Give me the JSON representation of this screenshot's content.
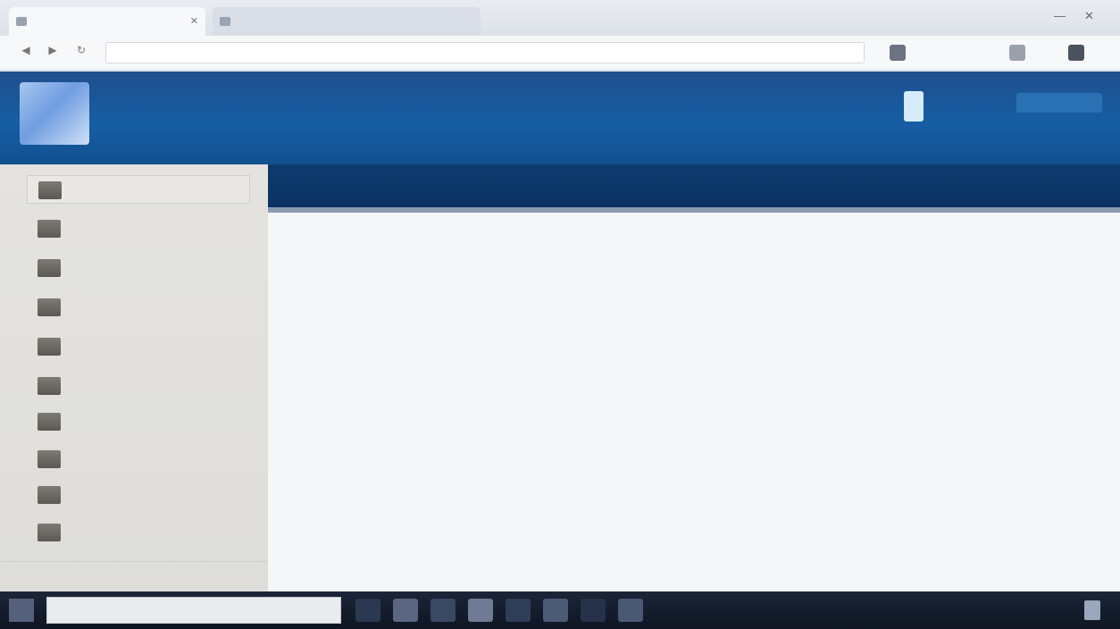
{
  "browser": {
    "tabs": [
      {
        "label": ""
      },
      {
        "label": ""
      }
    ],
    "address": {
      "value": "",
      "placeholder": ""
    },
    "window_controls": {
      "minimize": "—",
      "close": "✕"
    }
  },
  "app": {
    "title": "",
    "user_label": ""
  },
  "sidebar": {
    "items": [
      {
        "label": ""
      },
      {
        "label": ""
      },
      {
        "label": ""
      },
      {
        "label": ""
      },
      {
        "label": ""
      },
      {
        "label": ""
      },
      {
        "label": ""
      },
      {
        "label": ""
      },
      {
        "label": ""
      },
      {
        "label": ""
      }
    ],
    "footer": {
      "left_link": "",
      "right_link": ""
    }
  },
  "content": {
    "title": "",
    "paragraph_lines": [
      "",
      "",
      "",
      "",
      "",
      ""
    ],
    "section_heading": "",
    "section_link": ""
  },
  "taskbar": {
    "search": {
      "value": "",
      "placeholder": ""
    },
    "clock": ""
  },
  "colors": {
    "header_blue": "#165ea4",
    "content_header_navy": "#0f3b70",
    "sidebar_bg": "#e4e3df",
    "taskbar_dark": "#1c2638"
  },
  "icons": {
    "help": "help-icon",
    "start": "windows-start-icon",
    "notifications": "notification-icon"
  }
}
